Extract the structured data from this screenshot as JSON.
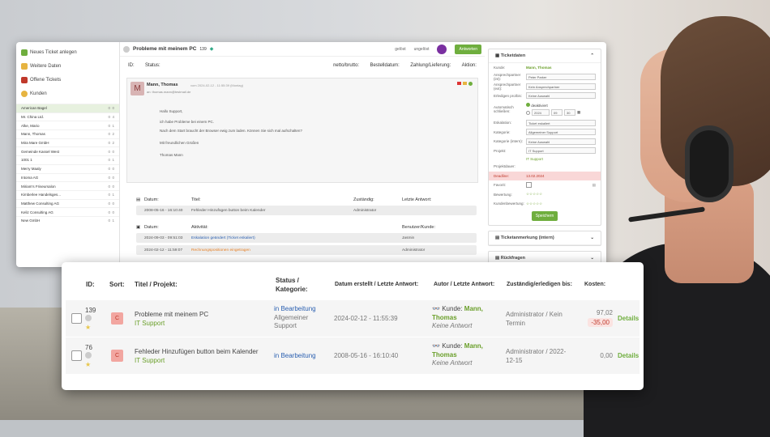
{
  "sidebar": {
    "links": [
      {
        "label": "Neues Ticket anlegen",
        "color": "#6fae3e"
      },
      {
        "label": "Weitere Daten",
        "color": "#e6b441"
      },
      {
        "label": "Offene Tickets",
        "color": "#c0392b"
      },
      {
        "label": "Kunden",
        "color": "#e6b441"
      }
    ],
    "customers": [
      {
        "name": "American Bagel",
        "a": "0",
        "b": "0",
        "selected": true
      },
      {
        "name": "Mr. China Ltd.",
        "a": "0",
        "b": "4"
      },
      {
        "name": "Alke, Mario",
        "a": "0",
        "b": "1"
      },
      {
        "name": "Mann, Thomas",
        "a": "0",
        "b": "2"
      },
      {
        "name": "Mira Mare GmbH",
        "a": "0",
        "b": "2"
      },
      {
        "name": "Gemeinde Kassel West",
        "a": "0",
        "b": "0"
      },
      {
        "name": "1001 1",
        "a": "0",
        "b": "1"
      },
      {
        "name": "Merry Maaly",
        "a": "0",
        "b": "0"
      },
      {
        "name": "Intoma AG",
        "a": "0",
        "b": "0"
      },
      {
        "name": "Miriam's Friseursalon",
        "a": "0",
        "b": "0"
      },
      {
        "name": "Kimberlee Handelsges...",
        "a": "0",
        "b": "1"
      },
      {
        "name": "Matthew Consulting AG",
        "a": "0",
        "b": "0"
      },
      {
        "name": "Keliz Consulting AG",
        "a": "0",
        "b": "0"
      },
      {
        "name": "New GmbH",
        "a": "0",
        "b": "1"
      }
    ]
  },
  "ticket": {
    "title": "Probleme mit meinem PC",
    "number": "139",
    "status_read": "gelöst",
    "status_unread": "ungelöst",
    "answer_button": "Antworten",
    "header_cols": [
      "ID:",
      "Status:",
      "netto/brutto:",
      "Bestelldatum:",
      "Zahlung/Lieferung:",
      "Aktion:"
    ],
    "author": "Mann, Thomas",
    "author_date": "vom 2024-02-12 - 11:55:39 (Montag)",
    "author_email": "an: thomas.mann@testmail.de",
    "body": [
      "Hallo Support,",
      "ich habe Probleme bei einem PC.",
      "Nach dem Start braucht der Browser ewig zum laden. Können Sie sich mal aufschalten?",
      "Mit freundlichen Grüßen",
      "Thomas Mann"
    ]
  },
  "related": {
    "head": [
      "Datum:",
      "Titel:",
      "Zuständig:",
      "Letzte Antwort:"
    ],
    "row": [
      "2008-05-16 - 16:10:40",
      "Fehleder Hinzufügen button beim Kalender",
      "Administrator",
      ""
    ]
  },
  "activity": {
    "head": [
      "Datum:",
      "Aktivität:",
      "Benutzer/Kunde:"
    ],
    "rows": [
      [
        "2024-09-03 - 09:51:03",
        "Eskalation geändert (Ticket eskaliert)",
        "Jasmin"
      ],
      [
        "2024-02-12 - 11:59:07",
        "Rechnungspositionen eingetragen",
        "Administrator"
      ]
    ]
  },
  "right_panel": {
    "title": "Ticketdaten",
    "customer_label": "Kunde:",
    "customer_value": "Mann, Thomas",
    "fields": [
      {
        "label": "Ansprechpartner (int):",
        "value": "Peter Parker"
      },
      {
        "label": "Ansprechpartner (ext):",
        "value": "Kein Ansprechpartner"
      },
      {
        "label": "Erledigen pro/bis:",
        "value": "Keine Auswahl"
      }
    ],
    "auto_close_label": "Automatisch schließen:",
    "auto_close_off": "deaktiviert",
    "date_parts": [
      "2024",
      "09",
      "30"
    ],
    "fields2": [
      {
        "label": "Eskalation:",
        "value": "Ticket eskaliert"
      },
      {
        "label": "Kategorie:",
        "value": "Allgemeiner Support"
      },
      {
        "label": "Kategorie (intern):",
        "value": "Keine Auswahl"
      },
      {
        "label": "Projekt:",
        "value": "IT Support"
      }
    ],
    "project_value": "IT Support",
    "project_period_label": "Projektdauer:",
    "deadline_label": "Deadline:",
    "deadline_value": "13.02.2024",
    "favorite_label": "Favorit:",
    "rating_label": "Bewertung:",
    "customer_rating_label": "Kundenbewertung:",
    "save_button": "Speichern",
    "section2": "Ticketanmerkung (intern)",
    "section3": "Rückfragen"
  },
  "float_table": {
    "headers": [
      "ID:",
      "Sort:",
      "Titel / Projekt:",
      "Status / Kategorie:",
      "Datum erstellt / Letzte Antwort:",
      "Autor / Letzte Antwort:",
      "Zuständig/erledigen bis:",
      "Kosten:"
    ],
    "rows": [
      {
        "id": "139",
        "sort": "C",
        "title": "Probleme mit meinem PC",
        "project": "IT Support",
        "status": "in Bearbeitung",
        "category": "Allgemeiner Support",
        "date": "2024-02-12 - 11:55:39",
        "author_prefix": "Kunde:",
        "author": "Mann, Thomas",
        "author_note": "Keine Antwort",
        "assigned": "Administrator / Kein Termin",
        "cost": "97,02",
        "cost_neg": "-35,00",
        "details": "Details"
      },
      {
        "id": "76",
        "sort": "C",
        "title": "Fehleder Hinzufügen button beim Kalender",
        "project": "IT Support",
        "status": "in Bearbeitung",
        "category": "",
        "date": "2008-05-16 - 16:10:40",
        "author_prefix": "Kunde:",
        "author": "Mann, Thomas",
        "author_note": "Keine Antwort",
        "assigned": "Administrator / 2022-12-15",
        "cost": "0,00",
        "cost_neg": "",
        "details": "Details"
      }
    ]
  }
}
